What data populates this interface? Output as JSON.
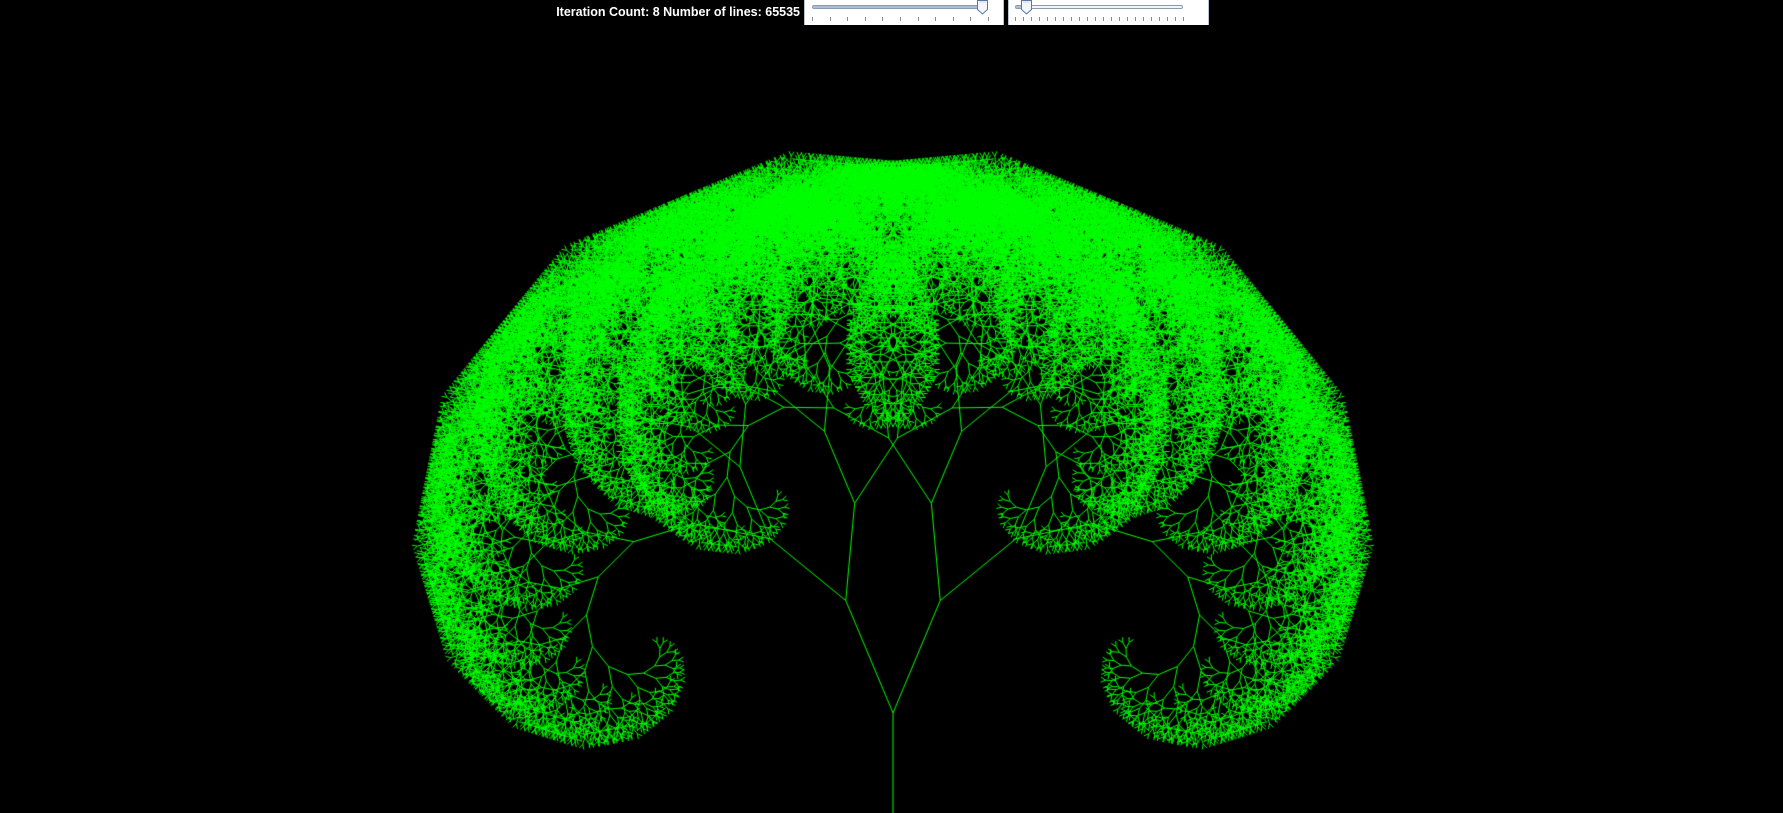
{
  "status": {
    "text": "Iteration Count: 8 Number of lines: 65535"
  },
  "controls": {
    "iteration_slider": {
      "value_fraction": 0.965,
      "tick_count": 10
    },
    "angle_slider": {
      "value_fraction": 0.065,
      "tick_count": 21
    }
  },
  "fractal": {
    "iterations": 8,
    "line_count": 65535,
    "branch_angle_degrees": 28,
    "length_ratio": 0.8,
    "background_color": "#000000",
    "line_color": "#00ff00"
  },
  "colors": {
    "slider_background": "#ffffff",
    "slider_track": "#8a9ab0",
    "slider_thumb": "#5a76a8"
  }
}
